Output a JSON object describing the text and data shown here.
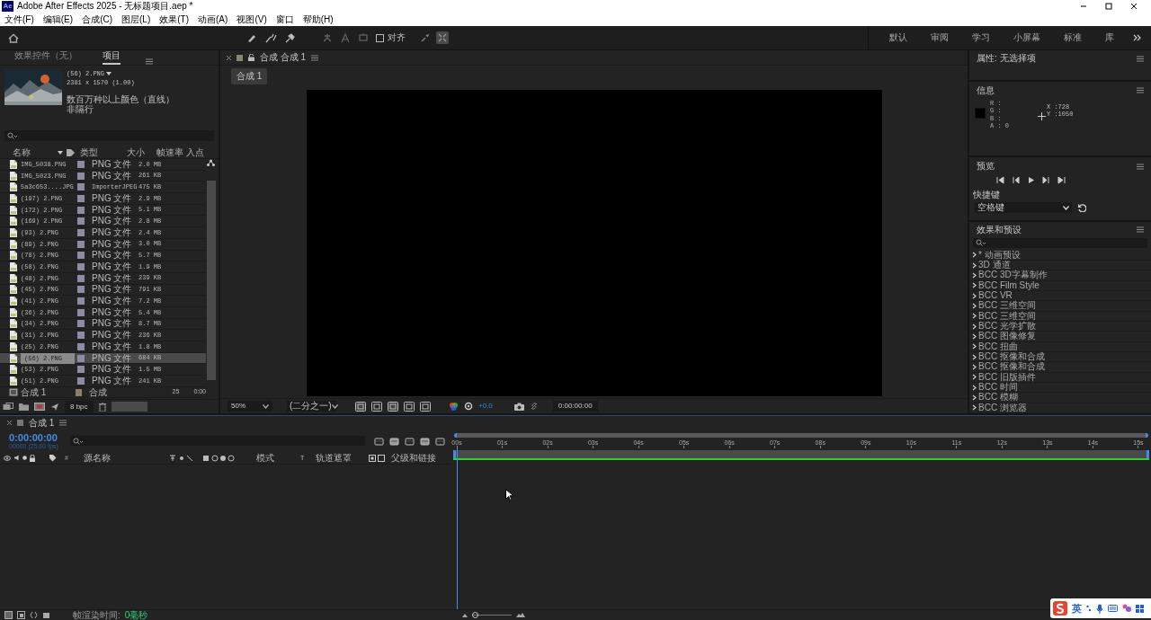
{
  "window": {
    "app_icon_text": "Ae",
    "title": "Adobe After Effects 2025 - 无标题项目.aep *"
  },
  "menu": [
    "文件(F)",
    "编辑(E)",
    "合成(C)",
    "图层(L)",
    "效果(T)",
    "动画(A)",
    "视图(V)",
    "窗口",
    "帮助(H)"
  ],
  "toolbar": {
    "snapping": {
      "label": "对齐",
      "checked": false
    }
  },
  "workspaces": [
    "默认",
    "审阅",
    "学习",
    "小屏幕",
    "标准",
    "库"
  ],
  "project_panel": {
    "tabs": [
      {
        "label": "效果控件（无）",
        "selected": false
      },
      {
        "label": "项目",
        "selected": true
      }
    ],
    "preview": {
      "name": "(56) 2.PNG",
      "dimensions": "2381 x 1570 (1.00)",
      "colors": "数百万种以上颜色（直线）",
      "field": "非隔行"
    },
    "columns": [
      "名称",
      "类型",
      "大小",
      "帧速率",
      "入点"
    ],
    "rows": [
      {
        "name": "IMG_5038.PNG",
        "kind": "file",
        "color": "#8c8ca6",
        "type": "PNG 文件",
        "size": "2.0 MB",
        "selected": false
      },
      {
        "name": "IMG_5023.PNG",
        "kind": "file",
        "color": "#8c8ca6",
        "type": "PNG 文件",
        "size": "261 KB",
        "selected": false
      },
      {
        "name": "5a3c653....JPG",
        "kind": "file",
        "color": "#8c8ca6",
        "type": "ImporterJPEG",
        "size": "475 KB",
        "selected": false
      },
      {
        "name": "(197) 2.PNG",
        "kind": "file",
        "color": "#8c8ca6",
        "type": "PNG 文件",
        "size": "2.9 MB",
        "selected": false
      },
      {
        "name": "(172) 2.PNG",
        "kind": "file",
        "color": "#8c8ca6",
        "type": "PNG 文件",
        "size": "5.1 MB",
        "selected": false
      },
      {
        "name": "(169) 2.PNG",
        "kind": "file",
        "color": "#8c8ca6",
        "type": "PNG 文件",
        "size": "2.8 MB",
        "selected": false
      },
      {
        "name": "(93) 2.PNG",
        "kind": "file",
        "color": "#8c8ca6",
        "type": "PNG 文件",
        "size": "2.4 MB",
        "selected": false
      },
      {
        "name": "(89) 2.PNG",
        "kind": "file",
        "color": "#8c8ca6",
        "type": "PNG 文件",
        "size": "3.0 MB",
        "selected": false
      },
      {
        "name": "(78) 2.PNG",
        "kind": "file",
        "color": "#8c8ca6",
        "type": "PNG 文件",
        "size": "5.7 MB",
        "selected": false
      },
      {
        "name": "(58) 2.PNG",
        "kind": "file",
        "color": "#8c8ca6",
        "type": "PNG 文件",
        "size": "1.9 MB",
        "selected": false
      },
      {
        "name": "(48) 2.PNG",
        "kind": "file",
        "color": "#8c8ca6",
        "type": "PNG 文件",
        "size": "239 KB",
        "selected": false
      },
      {
        "name": "(45) 2.PNG",
        "kind": "file",
        "color": "#8c8ca6",
        "type": "PNG 文件",
        "size": "791 KB",
        "selected": false
      },
      {
        "name": "(41) 2.PNG",
        "kind": "file",
        "color": "#8c8ca6",
        "type": "PNG 文件",
        "size": "7.2 MB",
        "selected": false
      },
      {
        "name": "(36) 2.PNG",
        "kind": "file",
        "color": "#8c8ca6",
        "type": "PNG 文件",
        "size": "5.4 MB",
        "selected": false
      },
      {
        "name": "(34) 2.PNG",
        "kind": "file",
        "color": "#8c8ca6",
        "type": "PNG 文件",
        "size": "8.7 MB",
        "selected": false
      },
      {
        "name": "(31) 2.PNG",
        "kind": "file",
        "color": "#8c8ca6",
        "type": "PNG 文件",
        "size": "236 KB",
        "selected": false
      },
      {
        "name": "(25) 2.PNG",
        "kind": "file",
        "color": "#8c8ca6",
        "type": "PNG 文件",
        "size": "1.8 MB",
        "selected": false
      },
      {
        "name": "(56) 2.PNG",
        "kind": "file",
        "color": "#8c8ca6",
        "type": "PNG 文件",
        "size": "684 KB",
        "selected": true
      },
      {
        "name": "(53) 2.PNG",
        "kind": "file",
        "color": "#8c8ca6",
        "type": "PNG 文件",
        "size": "1.5 MB",
        "selected": false
      },
      {
        "name": "(51) 2.PNG",
        "kind": "file",
        "color": "#8c8ca6",
        "type": "PNG 文件",
        "size": "241 KB",
        "selected": false
      },
      {
        "name": "合成 1",
        "kind": "comp",
        "color": "#8a806a",
        "type": "合成",
        "fps": "25",
        "in": "0:00",
        "selected": false
      }
    ],
    "bit_depth": "8 bpc"
  },
  "comp_panel": {
    "title": "合成 合成 1",
    "tab": "合成 1",
    "zoom": "50%",
    "resolution": "(二分之一)",
    "exposure": "+0.0",
    "timecode": "0:00:00:00"
  },
  "properties": {
    "title": "属性: 无选择项"
  },
  "info": {
    "title": "信息",
    "channels": [
      "R :",
      "G :",
      "B :",
      "A : 0"
    ],
    "x": "X :728",
    "y": "Y :1050"
  },
  "preview": {
    "title": "预览",
    "shortcut_label": "快捷键",
    "shortcut": "空格键"
  },
  "effects": {
    "title": "效果和预设",
    "items": [
      "* 动画预设",
      "3D 通道",
      "BCC 3D字幕制作",
      "BCC Film Style",
      "BCC VR",
      "BCC 三维空间",
      "BCC 三维空间",
      "BCC 光学扩散",
      "BCC 图像修复",
      "BCC 扭曲",
      "BCC 抠像和合成",
      "BCC 抠像和合成",
      "BCC 旧版插件",
      "BCC 时间",
      "BCC 模糊",
      "BCC 浏览器"
    ]
  },
  "timeline": {
    "tab": "合成 1",
    "time": "0:00:00:00",
    "frame_info": "00000 (25.00 fps)",
    "columns": [
      "#",
      "源名称",
      "模式",
      "T",
      "轨道遮罩",
      "父级和链接"
    ],
    "ruler": [
      "00s",
      "01s",
      "02s",
      "03s",
      "04s",
      "05s",
      "06s",
      "07s",
      "08s",
      "09s",
      "10s",
      "11s",
      "12s",
      "13s",
      "14s",
      "15s"
    ],
    "render_time_label": "帧渲染时间:",
    "render_time": "0毫秒",
    "zoom": {
      "level": 0
    }
  },
  "ime": {
    "mode": "英"
  }
}
